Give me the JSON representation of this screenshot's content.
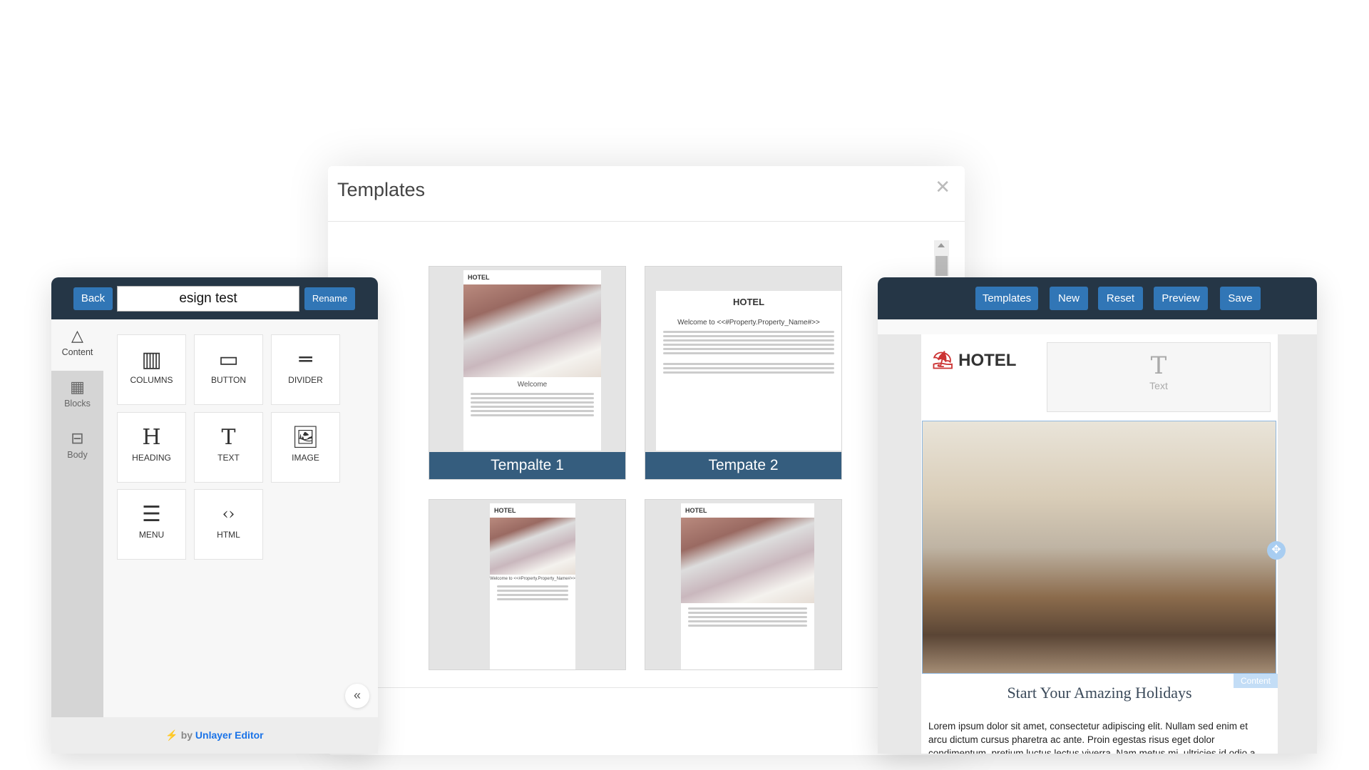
{
  "modal": {
    "title": "Templates",
    "close_icon": "close-icon",
    "templates": [
      {
        "label": "Tempalte 1",
        "preview_heading": "Welcome",
        "preview_brand": "HOTEL"
      },
      {
        "label": "Tempate 2",
        "preview_brand": "HOTEL",
        "preview_heading": "Welcome to <<#Property.Property_Name#>>"
      },
      {
        "label": "",
        "preview_brand": "HOTEL",
        "preview_heading": "Welcome to <<#Property.Property_Name#>>"
      },
      {
        "label": "",
        "preview_brand": "HOTEL"
      }
    ]
  },
  "left_panel": {
    "back": "Back",
    "design_name": "esign test",
    "rename": "Rename",
    "tabs": [
      {
        "label": "Content",
        "icon": "shapes-icon"
      },
      {
        "label": "Blocks",
        "icon": "blocks-icon"
      },
      {
        "label": "Body",
        "icon": "layout-icon"
      }
    ],
    "tools": [
      {
        "label": "COLUMNS",
        "icon": "columns-icon"
      },
      {
        "label": "BUTTON",
        "icon": "button-icon"
      },
      {
        "label": "DIVIDER",
        "icon": "divider-icon"
      },
      {
        "label": "HEADING",
        "icon": "heading-icon"
      },
      {
        "label": "TEXT",
        "icon": "text-icon"
      },
      {
        "label": "IMAGE",
        "icon": "image-icon"
      },
      {
        "label": "MENU",
        "icon": "menu-icon"
      },
      {
        "label": "HTML",
        "icon": "html-icon"
      }
    ],
    "footer_by": "by",
    "footer_link": "Unlayer Editor"
  },
  "right_panel": {
    "buttons": [
      "Templates",
      "New",
      "Reset",
      "Preview",
      "Save"
    ],
    "email": {
      "brand": "HOTEL",
      "text_placeholder": "Text",
      "content_tag": "Content",
      "heading": "Start Your Amazing Holidays",
      "paragraph": "Lorem ipsum dolor sit amet, consectetur adipiscing elit. Nullam sed enim et arcu dictum cursus pharetra ac ante. Proin egestas risus eget dolor condimentum, pretium luctus lectus viverra. Nam metus mi, ultricies id odio a, aliquam ornare."
    }
  },
  "colors": {
    "header": "#253646",
    "button": "#3176b6",
    "template_label": "#355d7e",
    "link": "#1a73e8"
  }
}
